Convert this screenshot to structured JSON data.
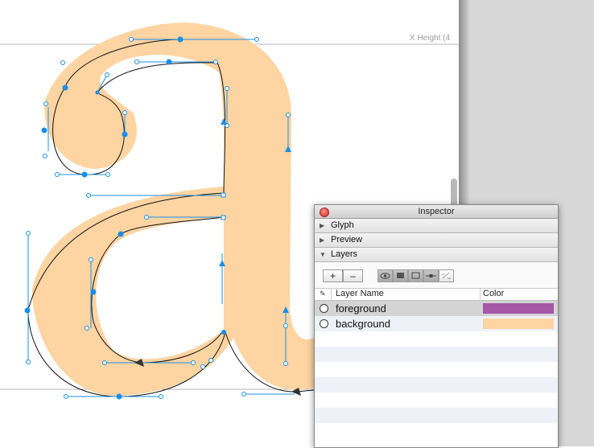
{
  "canvas": {
    "metric_label": "X Height (4",
    "glyph_fill_color": "#fdd4a2",
    "outline_color": "#111111",
    "point_color": "#1a8fe6",
    "metric_line_color": "#b5b5b5"
  },
  "inspector": {
    "title": "Inspector",
    "sections": {
      "glyph": "Glyph",
      "preview": "Preview",
      "layers": "Layers"
    },
    "toolbar": {
      "add_label": "+",
      "remove_label": "–"
    },
    "columns": {
      "name": "Layer Name",
      "color": "Color"
    },
    "layers": [
      {
        "name": "foreground",
        "color": "#a357a5",
        "selected": true
      },
      {
        "name": "background",
        "color": "#fdd4a2",
        "selected": false
      }
    ]
  }
}
